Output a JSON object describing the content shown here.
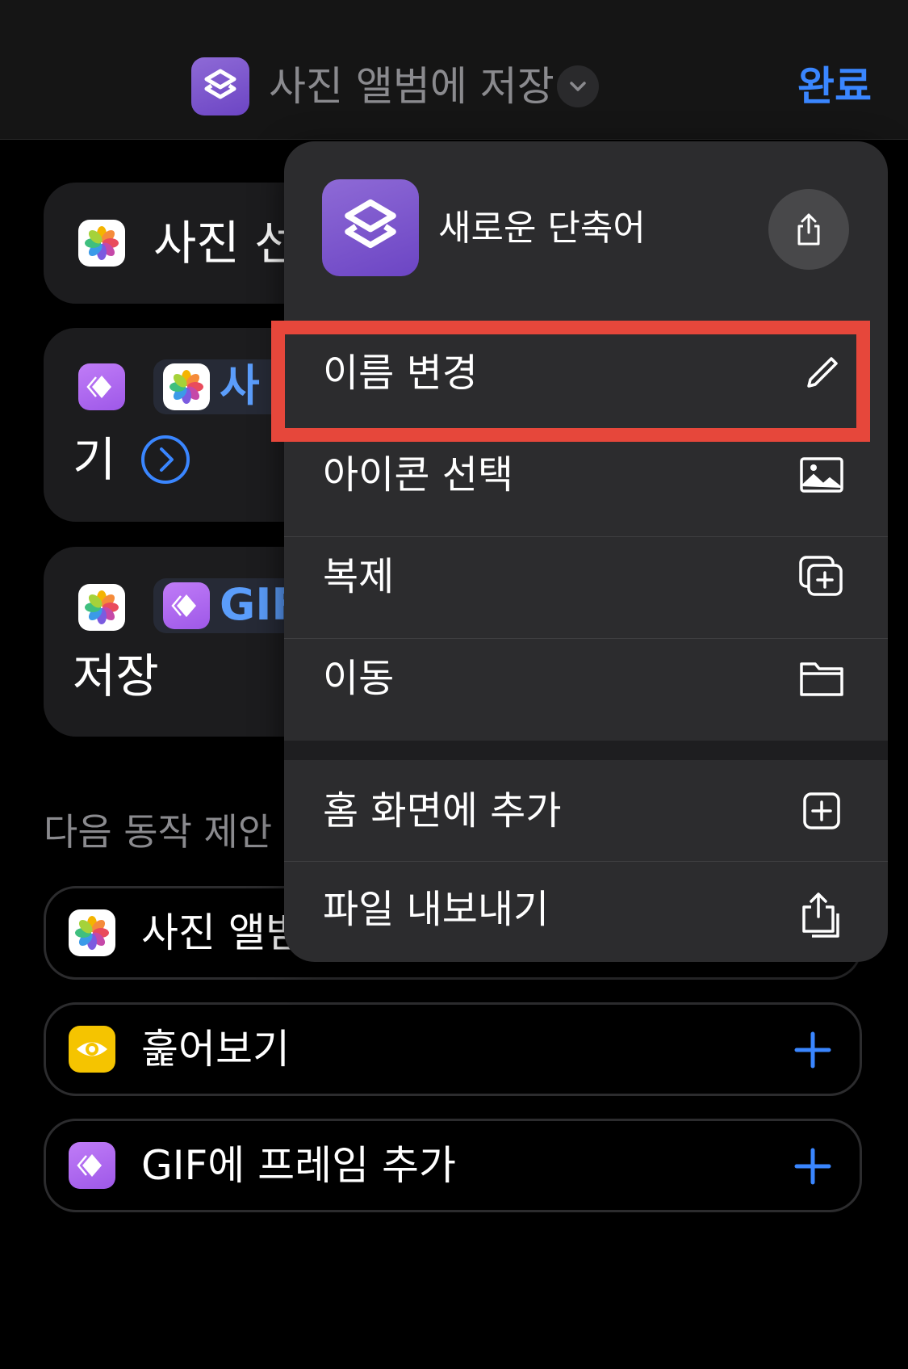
{
  "navbar": {
    "title": "사진 앨범에 저장",
    "done_label": "완료",
    "app_icon": "shortcuts-icon",
    "chevron_icon": "chevron-down-icon"
  },
  "actions": {
    "card1": {
      "text": "사진 선"
    },
    "card2": {
      "chip_text": "사",
      "text_line2": "기"
    },
    "card3": {
      "chip_text": "GIF",
      "text_line2": "저장"
    }
  },
  "suggestions": {
    "header": "다음 동작 제안",
    "items": [
      {
        "label": "사진 앨범",
        "icon": "photos-icon"
      },
      {
        "label": "훑어보기",
        "icon": "eye-icon"
      },
      {
        "label": "GIF에 프레임 추가",
        "icon": "gif-icon"
      }
    ]
  },
  "menu": {
    "app_name": "새로운 단축어",
    "share_icon": "share-icon",
    "items": [
      {
        "label": "이름 변경",
        "icon": "pencil-icon"
      },
      {
        "label": "아이콘 선택",
        "icon": "photo-icon"
      },
      {
        "label": "복제",
        "icon": "duplicate-icon"
      },
      {
        "label": "이동",
        "icon": "folder-icon"
      },
      {
        "label": "홈 화면에 추가",
        "icon": "add-square-icon"
      },
      {
        "label": "파일 내보내기",
        "icon": "export-icon"
      }
    ]
  },
  "colors": {
    "accent": "#3a86ff",
    "highlight": "#e6473b",
    "menu_bg": "#2c2c2e",
    "shortcuts_purple": "#7b55cc",
    "gif_purple": "#b06ef2",
    "eye_yellow": "#f5c400"
  }
}
